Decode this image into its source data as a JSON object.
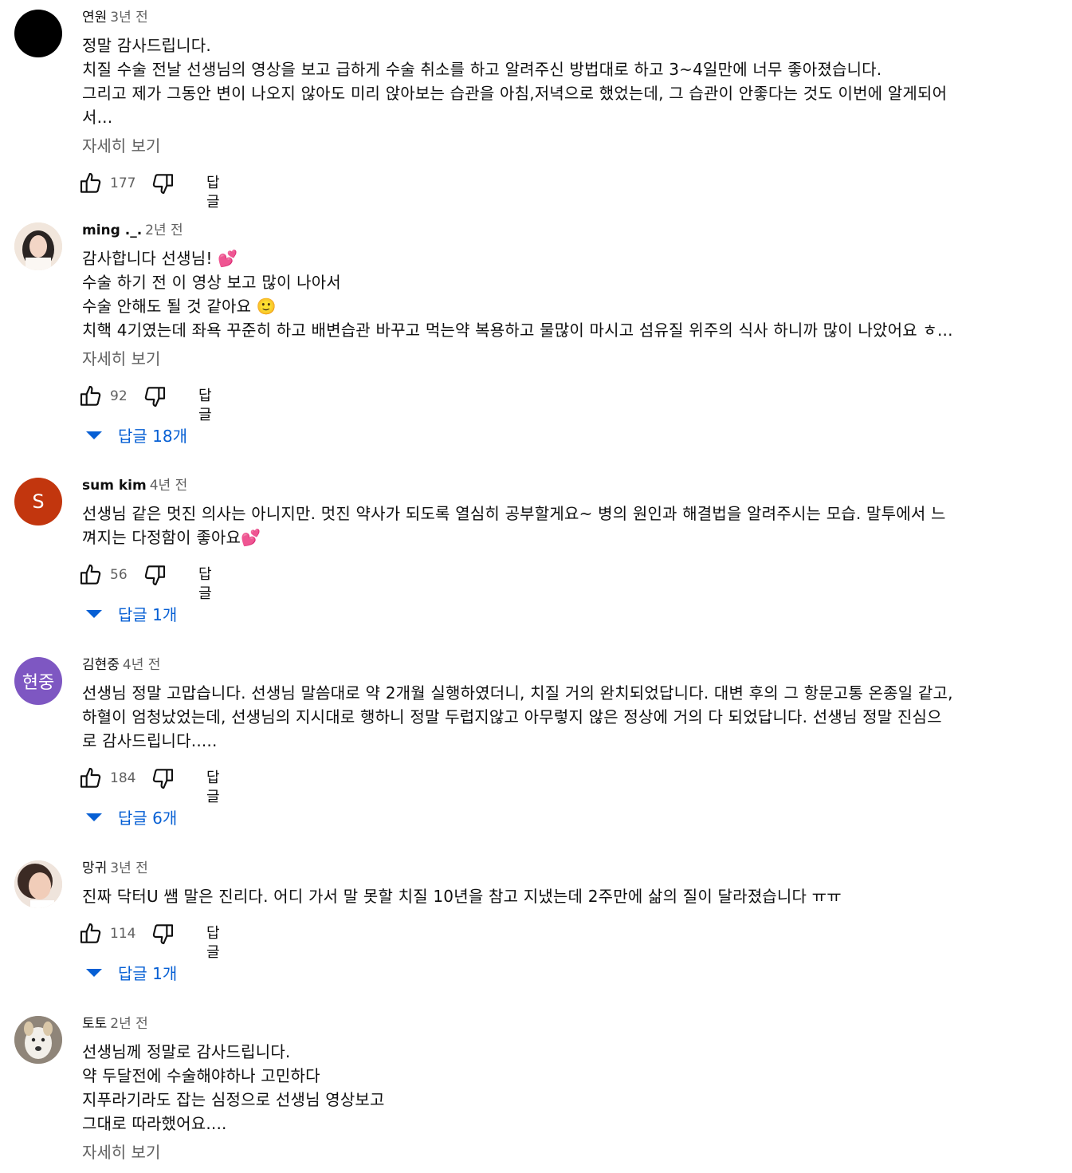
{
  "colors": {
    "link": "#065fd4",
    "meta": "#606060",
    "text": "#0f0f0f"
  },
  "icons": {
    "like": "thumb-up-icon",
    "dislike": "thumb-down-icon",
    "expand": "triangle-down-icon"
  },
  "comments": [
    {
      "author": "연원",
      "time": "3년 전",
      "avatar_text": "",
      "body": [
        "정말 감사드립니다.",
        "치질 수술 전날 선생님의 영상을 보고 급하게 수술 취소를 하고 알려주신 방법대로 하고 3~4일만에 너무 좋아졌습니다.",
        "그리고 제가 그동안 변이 나오지 않아도 미리 앉아보는 습관을 아침,저녁으로 했었는데,  그 습관이 안좋다는 것도 이번에 알게되어",
        "서..."
      ],
      "more": "자세히 보기",
      "likes": "177",
      "reply_label": "답글",
      "replies": ""
    },
    {
      "author": "ming ._.",
      "time": "2년 전",
      "avatar_text": "",
      "body": [
        "감사합니다 선생님! 💕",
        "수술 하기 전 이 영상 보고 많이 나아서",
        "수술 안해도 될 것 같아요 🙂",
        "치핵 4기였는데 좌욕 꾸준히 하고 배변습관 바꾸고 먹는약 복용하고 물많이 마시고 섬유질 위주의 식사 하니까 많이 나았어요 ㅎ..."
      ],
      "more": "자세히 보기",
      "likes": "92",
      "reply_label": "답글",
      "replies": "답글 18개"
    },
    {
      "author": "sum kim",
      "time": "4년 전",
      "avatar_text": "S",
      "body": [
        "선생님 같은 멋진 의사는 아니지만. 멋진 약사가 되도록 열심히 공부할게요~ 병의 원인과 해결법을 알려주시는 모습. 말투에서 느",
        "껴지는 다정함이 좋아요💕"
      ],
      "more": "",
      "likes": "56",
      "reply_label": "답글",
      "replies": "답글 1개"
    },
    {
      "author": "김현중",
      "time": "4년 전",
      "avatar_text": "현중",
      "body": [
        "선생님 정말 고맙습니다. 선생님 말씀대로 약 2개월 실행하였더니, 치질 거의 완치되었답니다. 대변 후의 그 항문고통 온종일 같고,",
        "하혈이 엄청났었는데, 선생님의 지시대로 행하니 정말 두럽지않고 아무렇지 않은 정상에 거의 다 되었답니다. 선생님 정말 진심으",
        "로 감사드립니다....."
      ],
      "more": "",
      "likes": "184",
      "reply_label": "답글",
      "replies": "답글 6개"
    },
    {
      "author": "망귀",
      "time": "3년 전",
      "avatar_text": "",
      "body": [
        "진짜 닥터U 쌤 말은 진리다. 어디 가서 말 못할 치질 10년을 참고 지냈는데 2주만에 삶의 질이 달라졌습니다 ㅠㅠ"
      ],
      "more": "",
      "likes": "114",
      "reply_label": "답글",
      "replies": "답글 1개"
    },
    {
      "author": "토토",
      "time": "2년 전",
      "avatar_text": "",
      "body": [
        "선생님께 정말로 감사드립니다.",
        "약 두달전에 수술해야하나 고민하다",
        "지푸라기라도 잡는 심정으로 선생님 영상보고",
        "그대로 따라했어요...."
      ],
      "more": "자세히 보기",
      "likes": "",
      "reply_label": "",
      "replies": ""
    }
  ]
}
